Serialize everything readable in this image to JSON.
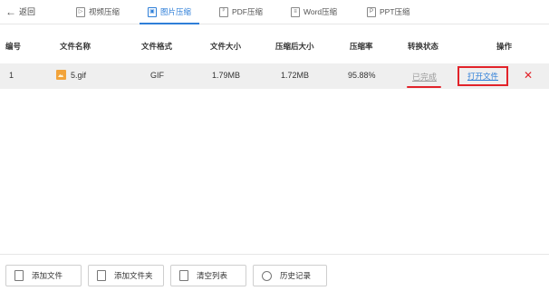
{
  "nav": {
    "back_label": "返回",
    "tabs": [
      {
        "label": "视频压缩",
        "icon": "video-icon",
        "active": false
      },
      {
        "label": "图片压缩",
        "icon": "image-icon",
        "active": true
      },
      {
        "label": "PDF压缩",
        "icon": "pdf-icon",
        "active": false
      },
      {
        "label": "Word压缩",
        "icon": "word-icon",
        "active": false
      },
      {
        "label": "PPT压缩",
        "icon": "ppt-icon",
        "active": false
      }
    ]
  },
  "table": {
    "headers": [
      "编号",
      "文件名称",
      "文件格式",
      "文件大小",
      "压缩后大小",
      "压缩率",
      "转换状态",
      "操作"
    ],
    "rows": [
      {
        "index": "1",
        "file_name": "5.gif",
        "format": "GIF",
        "size": "1.79MB",
        "compressed_size": "1.72MB",
        "ratio": "95.88%",
        "status": "已完成",
        "action": "打开文件",
        "delete_symbol": "✕"
      }
    ]
  },
  "toolbar": {
    "add_file": "添加文件",
    "add_folder": "添加文件夹",
    "clear_list": "清空列表",
    "history": "历史记录"
  },
  "colors": {
    "accent": "#2f7fd8",
    "highlight_red": "#e2232a",
    "row_bg": "#efefef"
  }
}
